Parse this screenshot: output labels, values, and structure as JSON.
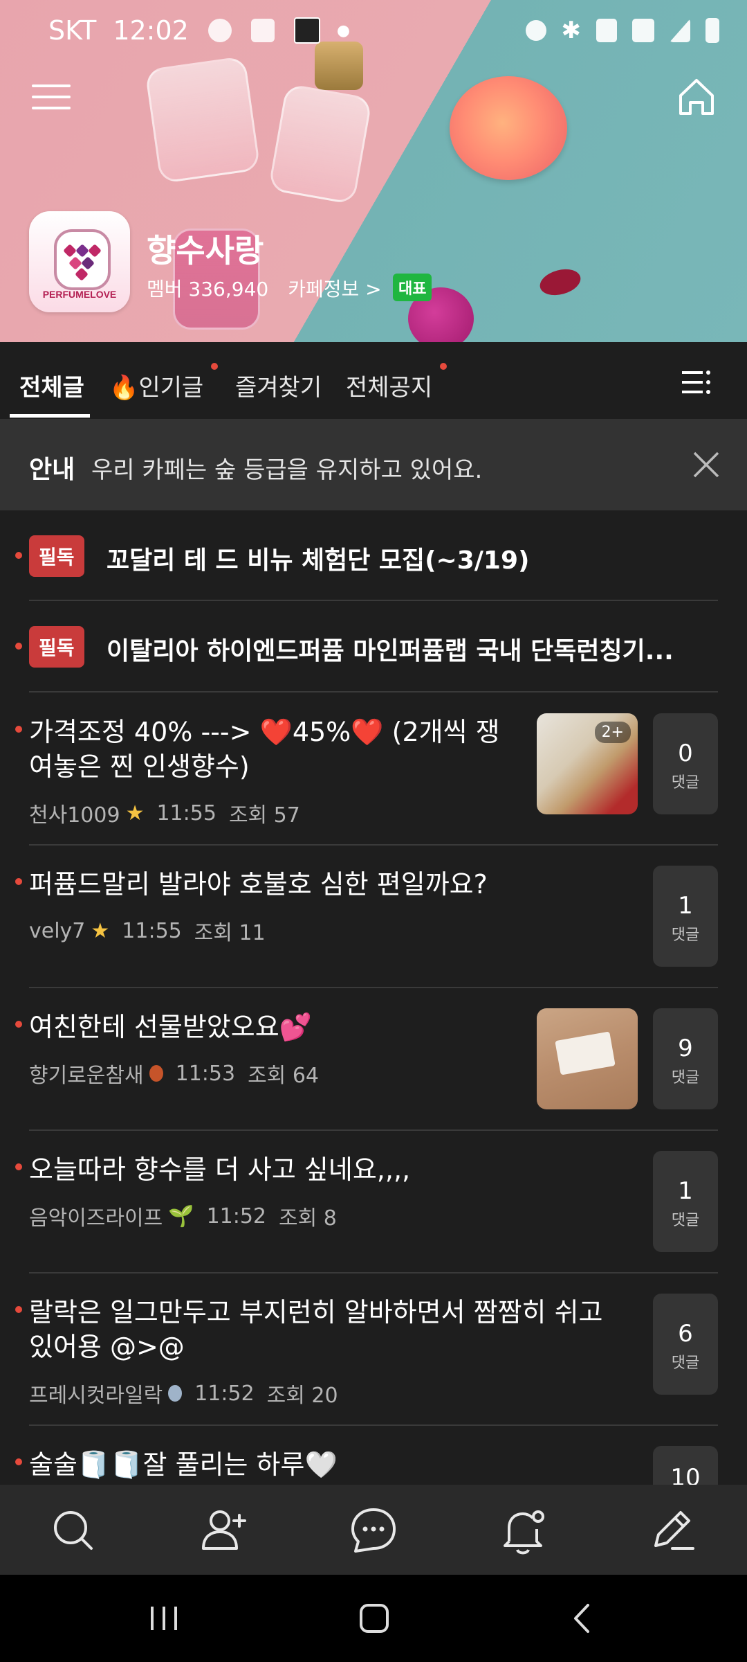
{
  "status_bar": {
    "carrier": "SKT",
    "time": "12:02",
    "left_icons": [
      "talk-icon",
      "gallery-icon",
      "hago-icon"
    ],
    "right_icons": [
      "alarm-icon",
      "bluetooth-icon",
      "mute-icon",
      "5g-icon",
      "signal-icon",
      "battery-icon"
    ]
  },
  "header": {
    "cafe_name": "향수사랑",
    "member_label": "멤버 336,940",
    "cafe_info": "카페정보 >",
    "badge": "대표",
    "logo_text": "PERFUMELOVE"
  },
  "tabs": [
    {
      "label": "전체글",
      "active": true
    },
    {
      "label": "🔥인기글",
      "active": false,
      "new": true
    },
    {
      "label": "즐겨찾기",
      "active": false
    },
    {
      "label": "전체공지",
      "active": false,
      "new": true
    }
  ],
  "notice": {
    "label": "안내",
    "text": "우리 카페는 숲 등급을 유지하고 있어요."
  },
  "pinned_posts": [
    {
      "tag": "필독",
      "title": "꼬달리 테 드 비뉴 체험단 모집(~3/19)"
    },
    {
      "tag": "필독",
      "title": "이탈리아 하이엔드퍼퓸 마인퍼퓸랩 국내 단독런칭기..."
    }
  ],
  "posts": [
    {
      "title_line1": "가격조정 40% ---> ❤️45%❤️ (2개씩 쟁",
      "title_line2": "여놓은 찐 인생향수)",
      "author": "천사1009",
      "time": "11:55",
      "views": "조회 57",
      "comments": "0",
      "comment_label": "댓글",
      "thumb_count": "2+"
    },
    {
      "title_line1": "퍼퓸드말리 발라야 호불호 심한 편일까요?",
      "author": "vely7",
      "time": "11:55",
      "views": "조회 11",
      "comments": "1",
      "comment_label": "댓글"
    },
    {
      "title_line1": "여친한테 선물받았오요💕",
      "author": "향기로운참새",
      "time": "11:53",
      "views": "조회 64",
      "comments": "9",
      "comment_label": "댓글"
    },
    {
      "title_line1": "오늘따라 향수를 더 사고 싶네요,,,,",
      "author": "음악이즈라이프",
      "time": "11:52",
      "views": "조회 8",
      "comments": "1",
      "comment_label": "댓글"
    },
    {
      "title_line1": "랄락은 일그만두고 부지런히 알바하면서 짬짬히 쉬고",
      "title_line2": "있어용 @>@",
      "author": "프레시컷라일락",
      "time": "11:52",
      "views": "조회 20",
      "comments": "6",
      "comment_label": "댓글"
    },
    {
      "title_line1": "술술🧻🧻잘 풀리는 하루🤍",
      "comments": "10"
    }
  ],
  "bottom_nav": [
    "search-icon",
    "add-member-icon",
    "chat-icon",
    "notification-settings-icon",
    "write-icon"
  ],
  "colors": {
    "accent_red": "#e64a3c",
    "pinned_bg": "#c93b3b",
    "background": "#1e1e1e",
    "badge_green": "#1fb640"
  }
}
